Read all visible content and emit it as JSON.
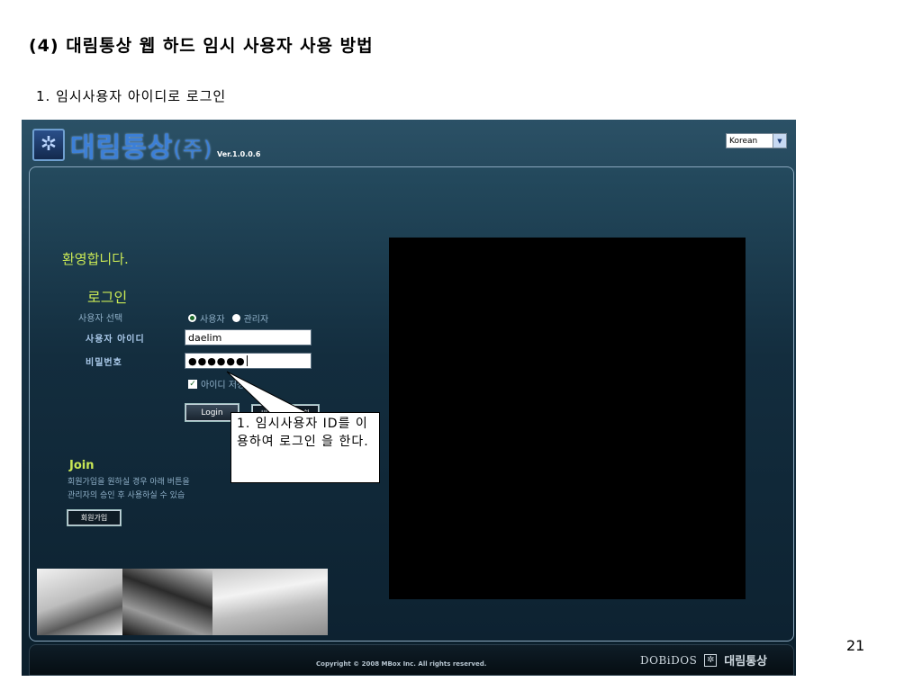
{
  "slide": {
    "title": "(4) 대림통상 웹 하드 임시 사용자 사용 방법",
    "step": "1. 임시사용자 아이디로 로그인",
    "page_number": "21"
  },
  "app": {
    "logo_text": "대림통상",
    "logo_suffix": "(주)",
    "logo_mark_icon": "daelim-star-icon",
    "version": "Ver.1.0.0.6",
    "language": {
      "selected": "Korean"
    },
    "welcome": "환영합니다.",
    "login": {
      "title": "로그인",
      "user_type_label": "사용자 선택",
      "user_type_options": [
        "사용자",
        "관리자"
      ],
      "user_type_selected": "사용자",
      "id_label": "사용자 아이디",
      "id_value": "daelim",
      "password_label": "비밀번호",
      "password_value": "●●●●●●",
      "remember_label": "아이디 저장",
      "remember_checked": true,
      "login_button": "Login",
      "reset_button": "비밀번호 초기화"
    },
    "join": {
      "title": "Join",
      "line1": "회원가입을 원하실 경우 아래 버튼을",
      "line2": "관리자의 승인 후 사용하실 수 있습",
      "button": "회원가입"
    },
    "footer": {
      "copyright": "Copyright © 2008 MBox Inc. All rights reserved.",
      "brand1": "DOBiDOS",
      "brand2": "대림통상"
    }
  },
  "callout": {
    "text": "1. 임시사용자 ID를 이용하여 로그인 을 한다."
  },
  "colors": {
    "accent_green": "#c9e855",
    "logo_blue": "#3c7fd6",
    "panel_dark": "#132d3e"
  }
}
